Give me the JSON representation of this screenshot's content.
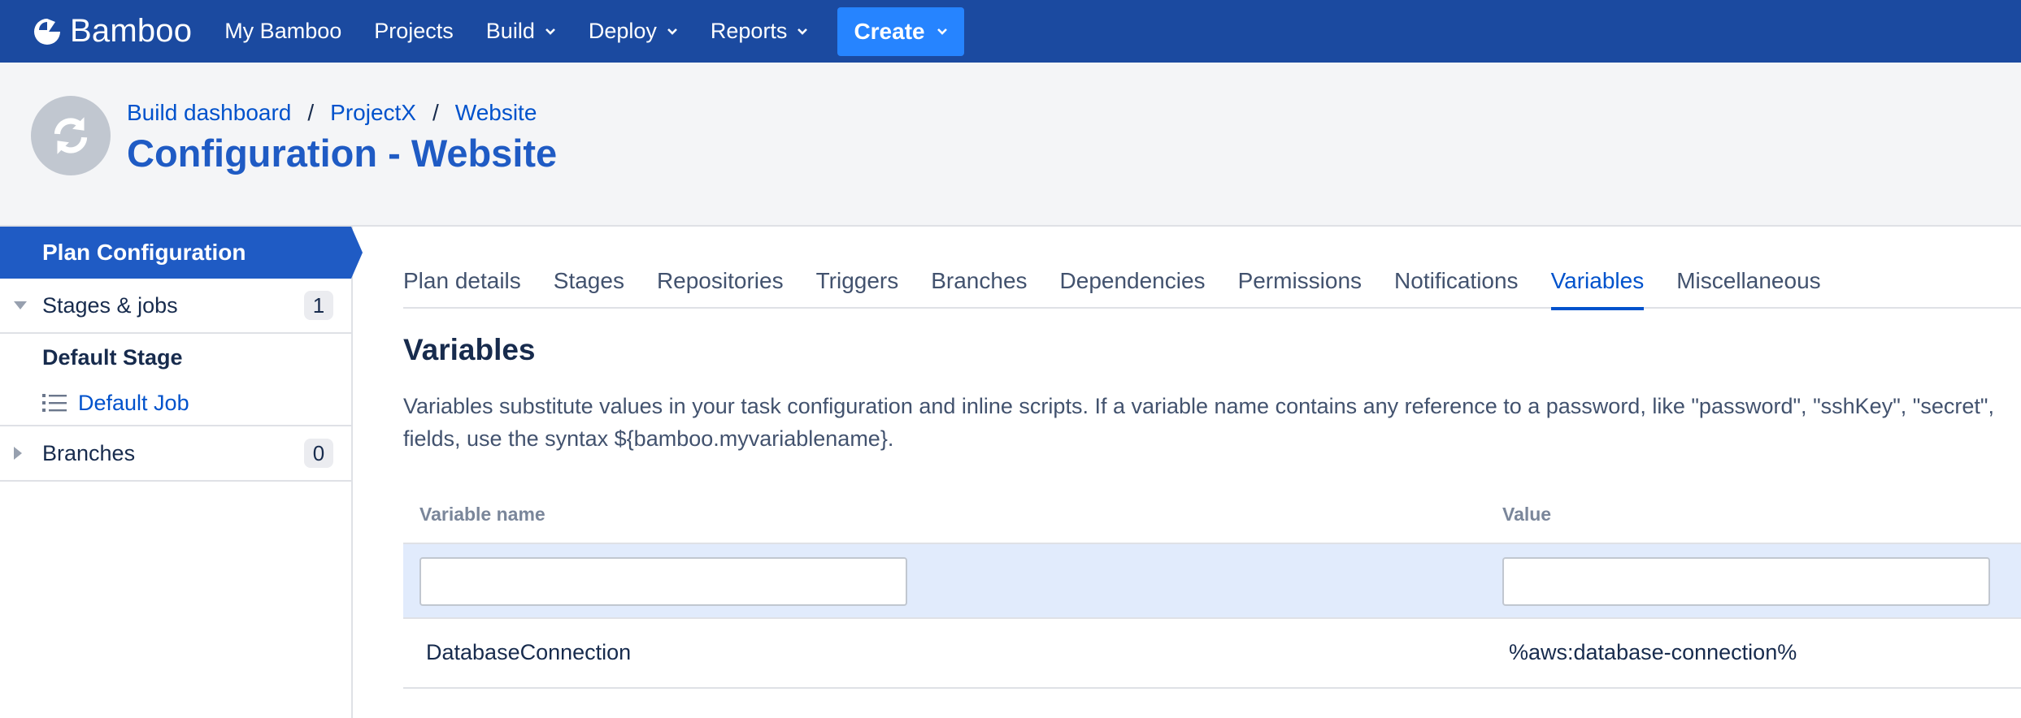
{
  "app": {
    "name": "Bamboo"
  },
  "nav": {
    "items": [
      {
        "label": "My Bamboo",
        "dropdown": false
      },
      {
        "label": "Projects",
        "dropdown": false
      },
      {
        "label": "Build",
        "dropdown": true
      },
      {
        "label": "Deploy",
        "dropdown": true
      },
      {
        "label": "Reports",
        "dropdown": true
      }
    ],
    "create_label": "Create"
  },
  "header": {
    "breadcrumb": [
      "Build dashboard",
      "ProjectX",
      "Website"
    ],
    "breadcrumb_separator": "/",
    "title": "Configuration - Website"
  },
  "sidebar": {
    "active_label": "Plan Configuration",
    "stages_jobs": {
      "label": "Stages & jobs",
      "count": "1"
    },
    "default_stage": "Default Stage",
    "default_job": "Default Job",
    "branches": {
      "label": "Branches",
      "count": "0"
    }
  },
  "tabs": [
    {
      "label": "Plan details",
      "active": false
    },
    {
      "label": "Stages",
      "active": false
    },
    {
      "label": "Repositories",
      "active": false
    },
    {
      "label": "Triggers",
      "active": false
    },
    {
      "label": "Branches",
      "active": false
    },
    {
      "label": "Dependencies",
      "active": false
    },
    {
      "label": "Permissions",
      "active": false
    },
    {
      "label": "Notifications",
      "active": false
    },
    {
      "label": "Variables",
      "active": true
    },
    {
      "label": "Miscellaneous",
      "active": false
    }
  ],
  "main": {
    "section_title": "Variables",
    "description": "Variables substitute values in your task configuration and inline scripts. If a variable name contains any reference to a password, like \"password\", \"sshKey\", \"secret\", fields, use the syntax ${bamboo.myvariablename}.",
    "table": {
      "headers": {
        "name": "Variable name",
        "value": "Value"
      },
      "new_row": {
        "name_value": "",
        "value_value": ""
      },
      "rows": [
        {
          "name": "DatabaseConnection",
          "value": "%aws:database-connection%"
        }
      ]
    }
  },
  "colors": {
    "topnav": "#1b4aa0",
    "create_button": "#2684ff",
    "title": "#1f5bc4",
    "link": "#0052cc",
    "sidebar_active": "#1f5bc4",
    "input_row": "#e1ebfc"
  }
}
